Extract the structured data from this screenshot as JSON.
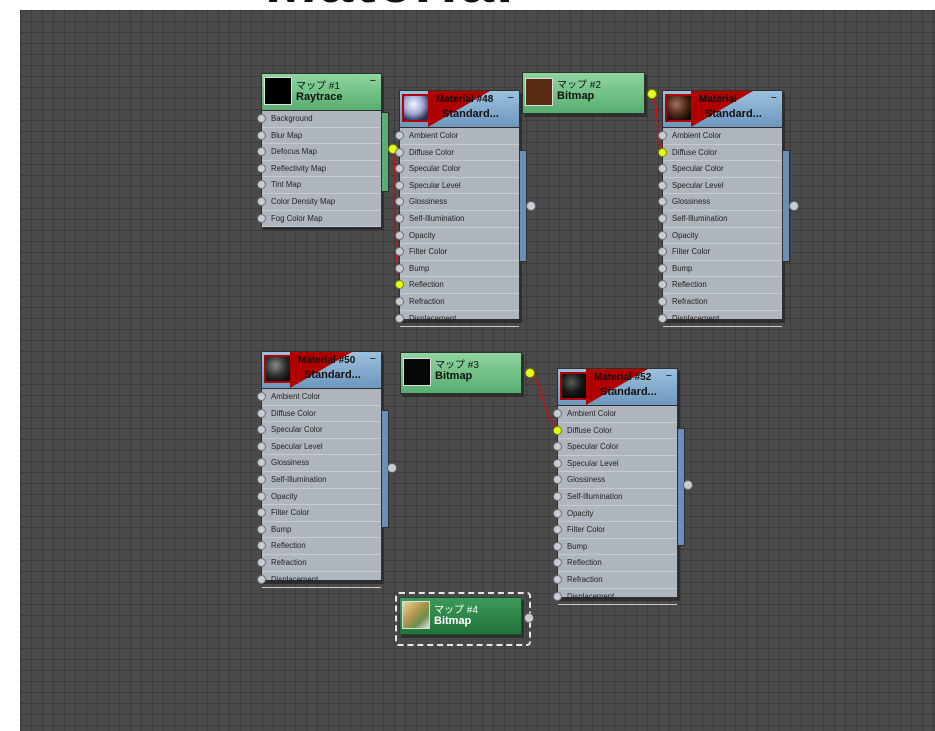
{
  "top_title": "Material",
  "material_slots": [
    "Ambient Color",
    "Diffuse Color",
    "Specular Color",
    "Specular Level",
    "Glossiness",
    "Self-Illumination",
    "Opacity",
    "Filter Color",
    "Bump",
    "Reflection",
    "Refraction",
    "Displacement"
  ],
  "raytrace_slots": [
    "Background",
    "Blur Map",
    "Defocus Map",
    "Reflectivity Map",
    "Tint Map",
    "Color Density Map",
    "Fog Color Map"
  ],
  "nodes": {
    "map1": {
      "line1": "マップ #1",
      "line2": "Raytrace",
      "minimize": "−"
    },
    "map2": {
      "line1": "マップ #2",
      "line2": "Bitmap"
    },
    "map3": {
      "line1": "マップ #3",
      "line2": "Bitmap"
    },
    "map4": {
      "line1": "マップ #4",
      "line2": "Bitmap"
    },
    "mat48": {
      "line1": "Material #48",
      "line2": "Standard...",
      "minimize": "−"
    },
    "mat49": {
      "line1": "Material",
      "line2": "Standard...",
      "minimize": "−"
    },
    "mat50": {
      "line1": "Material #50",
      "line2": "Standard...",
      "minimize": "−"
    },
    "mat52": {
      "line1": "Material #52",
      "line2": "Standard...",
      "minimize": "−"
    }
  },
  "colors": {
    "map_header": "#58ad70",
    "material_header": "#6d97bd",
    "active_socket": "#e3ff1a",
    "wire": "#d01010",
    "canvas": "#4a4a4a"
  }
}
